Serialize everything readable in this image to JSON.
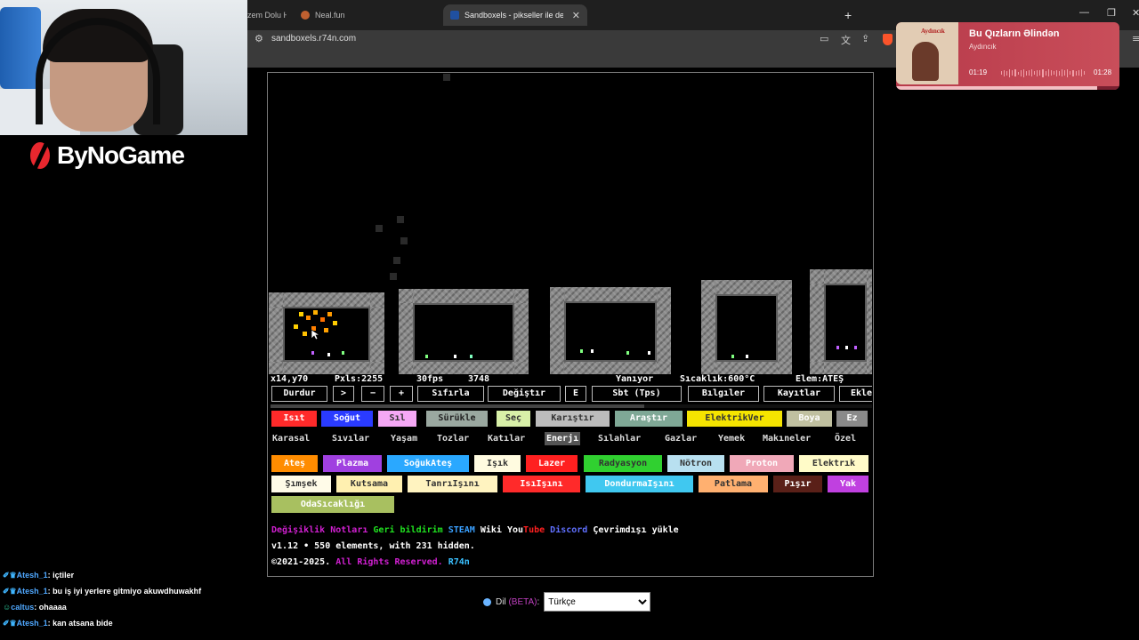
{
  "browser": {
    "tabs": [
      {
        "label": "zem Dolu H"
      },
      {
        "label": "Neal.fun"
      },
      {
        "label": "Sandboxels - pikseller ile deney"
      }
    ],
    "url": "sandboxels.r74n.com"
  },
  "stream": {
    "logo_text": "ByNoGame",
    "chat": [
      {
        "user": "Atesh_1",
        "message": "içtiler"
      },
      {
        "user": "Atesh_1",
        "message": "bu iş iyi yerlere gitmiyo akuwdhuwakhf"
      },
      {
        "user": "caltus",
        "message": "ohaaaa"
      },
      {
        "user": "Atesh_1",
        "message": "kan atsana bide"
      }
    ],
    "music": {
      "art_label": "Aydıncık",
      "title": "Bu Qızların Əlindən",
      "artist": "Aydıncık",
      "current": "01:19",
      "duration": "01:28",
      "progress": 0.9
    }
  },
  "game": {
    "status": {
      "coords": "x14,y70",
      "pixels": "Pxls:2255",
      "fps": "30fps",
      "ticks": "3748",
      "state": "Yanıyor",
      "temp": "Sıcaklık:600°C",
      "element": "Elem:ATEŞ"
    },
    "controls": [
      "Durdur",
      ">",
      "−",
      "+",
      "Sıfırla",
      "Değiştır",
      "E",
      "Sbt (Tps)",
      "Bılgıler",
      "Kayıtlar",
      "Ekle"
    ],
    "tools": [
      {
        "label": "Isıt",
        "bg": "#ff2a2a",
        "fg": "#ffffff"
      },
      {
        "label": "Soğut",
        "bg": "#2a3bff",
        "fg": "#ffffff"
      },
      {
        "label": "Sıl",
        "bg": "#f5a8f5",
        "fg": "#333333"
      },
      {
        "label": "Sürükle",
        "bg": "#9aa8a0",
        "fg": "#222222"
      },
      {
        "label": "Seç",
        "bg": "#d8f0a8",
        "fg": "#333333"
      },
      {
        "label": "Karıştır",
        "bg": "#bcbcbc",
        "fg": "#333333"
      },
      {
        "label": "Araştır",
        "bg": "#7fa896",
        "fg": "#ffffff"
      },
      {
        "label": "ElektrikVer",
        "bg": "#f5e400",
        "fg": "#333333"
      },
      {
        "label": "Boya",
        "bg": "#c0c0a0",
        "fg": "#ffffff"
      },
      {
        "label": "Ez",
        "bg": "#8a8a8a",
        "fg": "#ffffff"
      }
    ],
    "categories": [
      "Karasal",
      "Sıvılar",
      "Yaşam",
      "Tozlar",
      "Katılar",
      "Enerjı",
      "Sılahlar",
      "Gazlar",
      "Yemek",
      "Makıneler",
      "Özel"
    ],
    "active_category": "Enerjı",
    "elements": [
      {
        "label": "Ateş",
        "bg": "#ff8c00",
        "fg": "#ffffff"
      },
      {
        "label": "Plazma",
        "bg": "#a040e0",
        "fg": "#ffffff"
      },
      {
        "label": "SoğukAteş",
        "bg": "#2aa8ff",
        "fg": "#ffffff"
      },
      {
        "label": "Işık",
        "bg": "#fffbe0",
        "fg": "#333333"
      },
      {
        "label": "Lazer",
        "bg": "#ff2020",
        "fg": "#ffffff"
      },
      {
        "label": "Radyasyon",
        "bg": "#30d030",
        "fg": "#333333"
      },
      {
        "label": "Nötron",
        "bg": "#b8e0f0",
        "fg": "#333333"
      },
      {
        "label": "Proton",
        "bg": "#f0a8b8",
        "fg": "#ffffff"
      },
      {
        "label": "Elektrık",
        "bg": "#fffbc8",
        "fg": "#333333"
      },
      {
        "label": "Şımşek",
        "bg": "#fffbe8",
        "fg": "#333333"
      },
      {
        "label": "Kutsama",
        "bg": "#fff0b0",
        "fg": "#333333"
      },
      {
        "label": "TanrıIşını",
        "bg": "#fff3c0",
        "fg": "#333333"
      },
      {
        "label": "IsıIşını",
        "bg": "#ff2a2a",
        "fg": "#ffffff"
      },
      {
        "label": "DondurmaIşını",
        "bg": "#40c8f0",
        "fg": "#ffffff"
      },
      {
        "label": "Patlama",
        "bg": "#ffb070",
        "fg": "#333333"
      },
      {
        "label": "Pışır",
        "bg": "#5a2018",
        "fg": "#ffffff"
      },
      {
        "label": "Yak",
        "bg": "#c040e0",
        "fg": "#ffffff"
      },
      {
        "label": "OdaSıcaklığı",
        "bg": "#a8c060",
        "fg": "#ffffff"
      }
    ],
    "footer": {
      "links": [
        {
          "label": "Değişiklik Notları",
          "color": "#d020d0"
        },
        {
          "label": "Geri bildirim",
          "color": "#20e020"
        },
        {
          "label": "STEAM",
          "color": "#3aa0ff"
        },
        {
          "label": "Wiki",
          "color": "#ffffff"
        },
        {
          "label": "You",
          "color": "#ffffff"
        },
        {
          "label": "Tube",
          "color": "#ff2020"
        },
        {
          "label": "Discord",
          "color": "#6070ff"
        },
        {
          "label": "Çevrimdışı yükle",
          "color": "#ffffff"
        }
      ],
      "version": "v1.12 • 550 elements, with 231 hidden.",
      "copyright": "©2021-2025.",
      "rights": "All Rights Reserved.",
      "author": "R74n"
    }
  },
  "language": {
    "label": "Dil",
    "beta": "(BETA)",
    "colon": ":",
    "selected": "Türkçe"
  }
}
